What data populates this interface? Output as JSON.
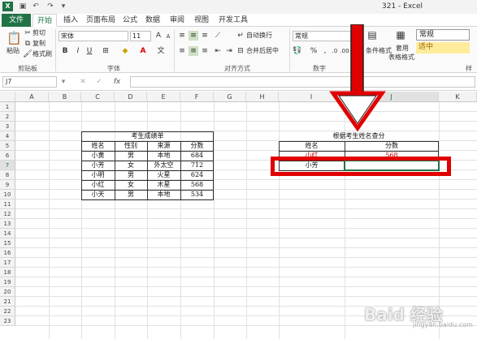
{
  "window": {
    "title": "321 - Excel",
    "app_icon": "X"
  },
  "ribbon_tabs": [
    "文件",
    "开始",
    "插入",
    "页面布局",
    "公式",
    "数据",
    "审阅",
    "视图",
    "开发工具"
  ],
  "ribbon": {
    "clipboard": {
      "paste": "粘贴",
      "cut": "剪切",
      "copy": "复制",
      "format_painter": "格式刷",
      "label": "剪贴板"
    },
    "font": {
      "name": "宋体",
      "size": "11",
      "bold": "B",
      "italic": "I",
      "underline": "U",
      "label": "字体"
    },
    "alignment": {
      "wrap": "自动换行",
      "merge": "合并后居中",
      "label": "对齐方式"
    },
    "number": {
      "format": "常规",
      "label": "数字"
    },
    "styles": {
      "conditional": "条件格式",
      "table": "套用",
      "table2": "表格格式",
      "normal": "常规",
      "neutral": "适中",
      "label": "样"
    }
  },
  "formula_bar": {
    "name_box": "J7",
    "fx": "fx"
  },
  "columns": [
    "A",
    "B",
    "C",
    "D",
    "E",
    "F",
    "G",
    "H",
    "I",
    "J",
    "K"
  ],
  "rows": [
    "1",
    "2",
    "3",
    "4",
    "5",
    "6",
    "7",
    "8",
    "9",
    "10",
    "11",
    "12",
    "13",
    "14",
    "15",
    "16",
    "17",
    "18",
    "19",
    "20",
    "21",
    "22",
    "23"
  ],
  "left_table": {
    "title": "考生成绩单",
    "headers": [
      "姓名",
      "性别",
      "来源",
      "分数"
    ],
    "rows": [
      [
        "小黄",
        "男",
        "本地",
        "684"
      ],
      [
        "小芳",
        "女",
        "外太空",
        "712"
      ],
      [
        "小明",
        "男",
        "火星",
        "624"
      ],
      [
        "小红",
        "女",
        "木星",
        "568"
      ],
      [
        "小天",
        "男",
        "本地",
        "534"
      ]
    ]
  },
  "right_table": {
    "title": "根据考生姓名查分",
    "headers": [
      "姓名",
      "分数"
    ],
    "row6": [
      "小红",
      "568"
    ],
    "row7": [
      "小芳",
      ""
    ]
  },
  "watermark": {
    "text": "Baid 经验",
    "sub": "jingyan.baidu.com"
  },
  "colors": {
    "excel_green": "#217346",
    "annotation_red": "#e00000"
  }
}
